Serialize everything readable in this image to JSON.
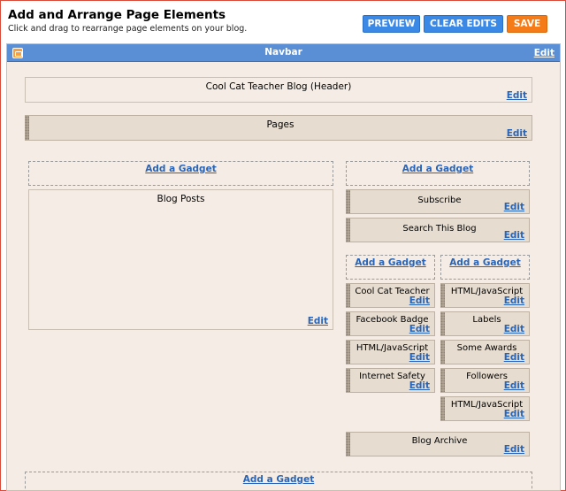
{
  "header": {
    "title": "Add and Arrange Page Elements",
    "subtitle": "Click and drag to rearrange page elements on your blog."
  },
  "toolbar": {
    "preview_label": "PREVIEW",
    "clear_edits_label": "CLEAR EDITS",
    "save_label": "SAVE"
  },
  "navbar": {
    "title": "Navbar",
    "edit": "Edit"
  },
  "layout": {
    "header_gadget": {
      "title": "Cool Cat Teacher Blog (Header)",
      "edit": "Edit"
    },
    "pages_gadget": {
      "title": "Pages",
      "edit": "Edit"
    },
    "main_add": "Add a Gadget",
    "blog_posts": {
      "title": "Blog Posts",
      "edit": "Edit"
    },
    "sidebar_add": "Add a Gadget",
    "sidebar_items": [
      {
        "title": "Subscribe",
        "edit": "Edit"
      },
      {
        "title": "Search This Blog",
        "edit": "Edit"
      }
    ],
    "left_col_add": "Add a Gadget",
    "left_col_items": [
      {
        "title": "Cool Cat Teacher",
        "edit": "Edit"
      },
      {
        "title": "Facebook Badge",
        "edit": "Edit"
      },
      {
        "title": "HTML/JavaScript",
        "edit": "Edit"
      },
      {
        "title": "Internet Safety",
        "edit": "Edit"
      }
    ],
    "right_col_add": "Add a Gadget",
    "right_col_items": [
      {
        "title": "HTML/JavaScript",
        "edit": "Edit"
      },
      {
        "title": "Labels",
        "edit": "Edit"
      },
      {
        "title": "Some Awards",
        "edit": "Edit"
      },
      {
        "title": "Followers",
        "edit": "Edit"
      },
      {
        "title": "HTML/JavaScript",
        "edit": "Edit"
      }
    ],
    "blog_archive": {
      "title": "Blog Archive",
      "edit": "Edit"
    },
    "footer_add": "Add a Gadget"
  }
}
